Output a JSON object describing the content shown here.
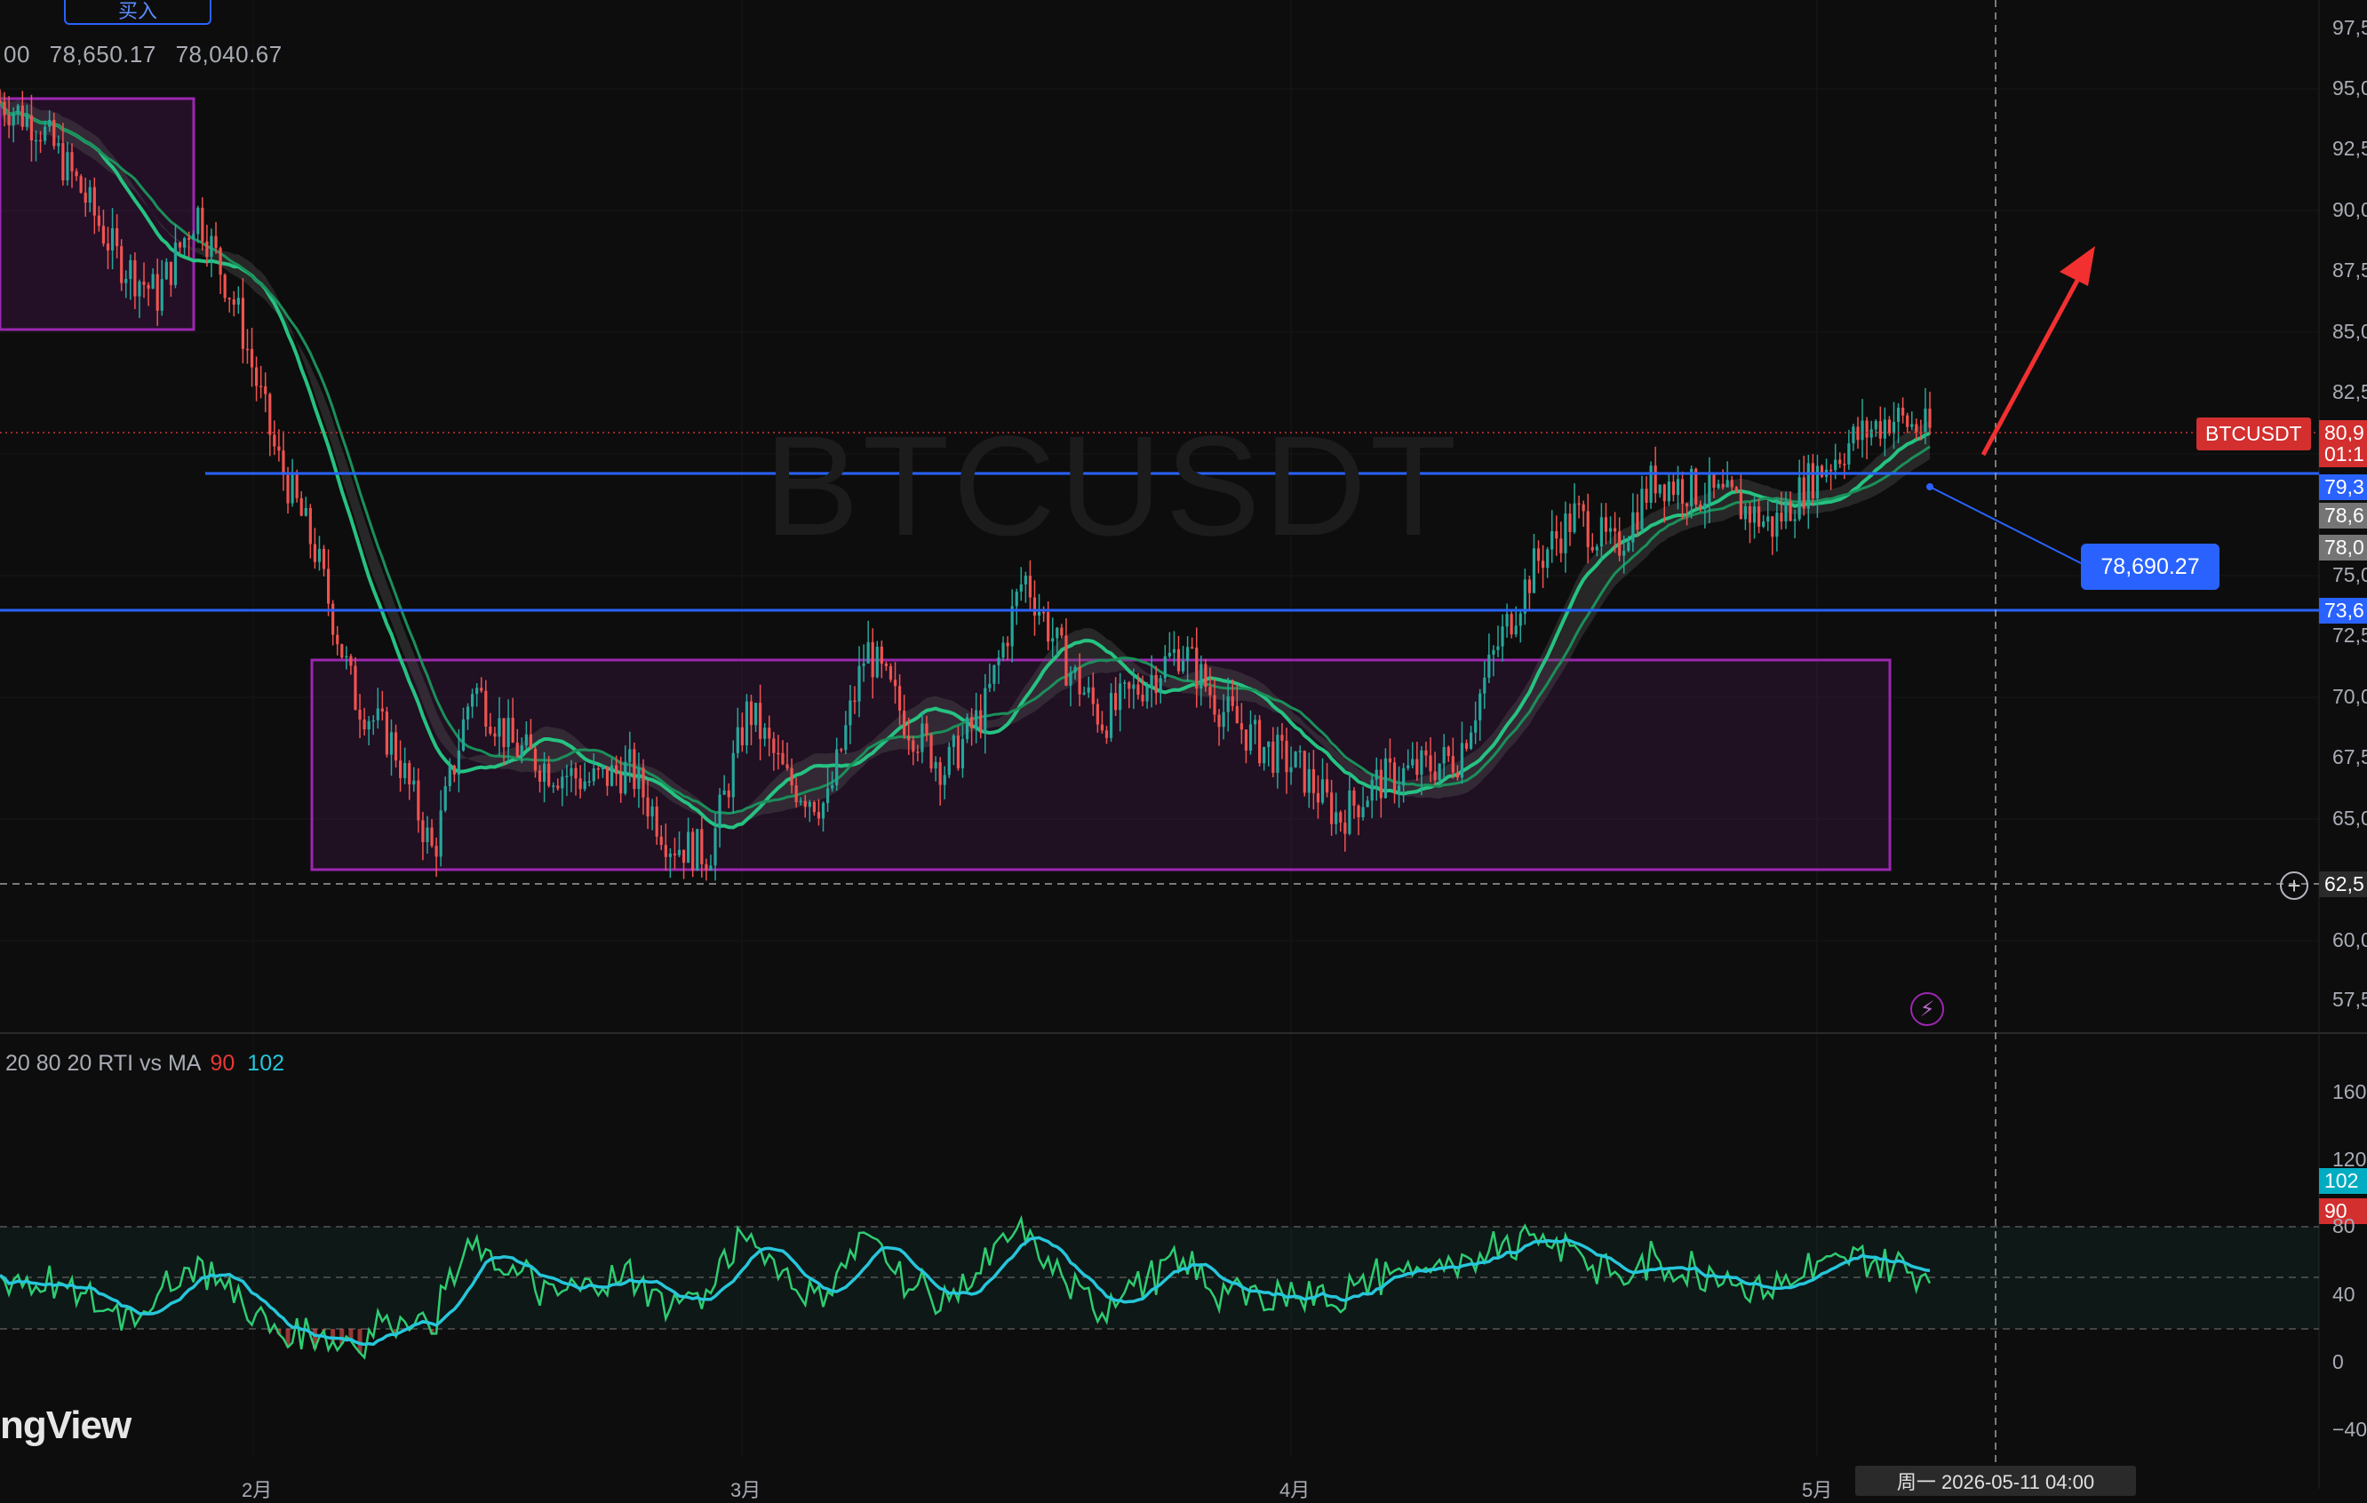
{
  "toolbar": {
    "buy_label": "买入",
    "ohlc_partial": "00",
    "ohlc_values": [
      "78,650.17",
      "78,040.67"
    ]
  },
  "chart": {
    "watermark": "BTCUSDT",
    "symbol_tag": "BTCUSDT",
    "price_axis_labels": [
      "97,5",
      "95,0",
      "92,5",
      "90,0",
      "87,5",
      "85,0",
      "82,5",
      "80,9",
      "01:1",
      "79,3",
      "78,6",
      "78,0",
      "75,0",
      "73,6",
      "72,5",
      "70,0",
      "67,5",
      "65,0",
      "62,5",
      "60,0",
      "57,5"
    ],
    "measure_label": "78,690.27",
    "time_labels": [
      "2月",
      "3月",
      "4月",
      "5月"
    ],
    "crosshair_time": "周一 2026-05-11 04:00"
  },
  "indicator": {
    "name": "20 80 20 RTI vs MA",
    "value1": "90",
    "value2": "102",
    "axis_labels": [
      "160",
      "120",
      "102",
      "90",
      "80",
      "40",
      "0",
      "−40"
    ]
  },
  "branding": {
    "logo": "ngView"
  },
  "colors": {
    "background": "#0d0d0d",
    "bull": "#26a69a",
    "bear": "#ef5350",
    "box": "#9c27b0",
    "line": "#2962ff",
    "ma": "#26c281"
  },
  "chart_data": {
    "type": "candlestick",
    "symbol": "BTCUSDT",
    "price_levels": [
      79300,
      73600
    ],
    "current_price": 80900,
    "consolidation_range": {
      "high": 71800,
      "low": 63000
    },
    "ylim": [
      57500,
      97500
    ],
    "close_trend": [
      94500,
      93500,
      91000,
      88000,
      86500,
      90000,
      86000,
      80000,
      76000,
      70000,
      68000,
      63500,
      70500,
      68000,
      67000,
      66500,
      67000,
      64000,
      63500,
      69500,
      66500,
      65500,
      72000,
      69000,
      67000,
      69500,
      75000,
      71500,
      69000,
      70500,
      72000,
      69500,
      68000,
      67000,
      65000,
      66500,
      67000,
      67500,
      72000,
      75500,
      77500,
      76000,
      79000,
      78500,
      78000,
      77000,
      79000,
      80500,
      81500,
      80900
    ]
  }
}
